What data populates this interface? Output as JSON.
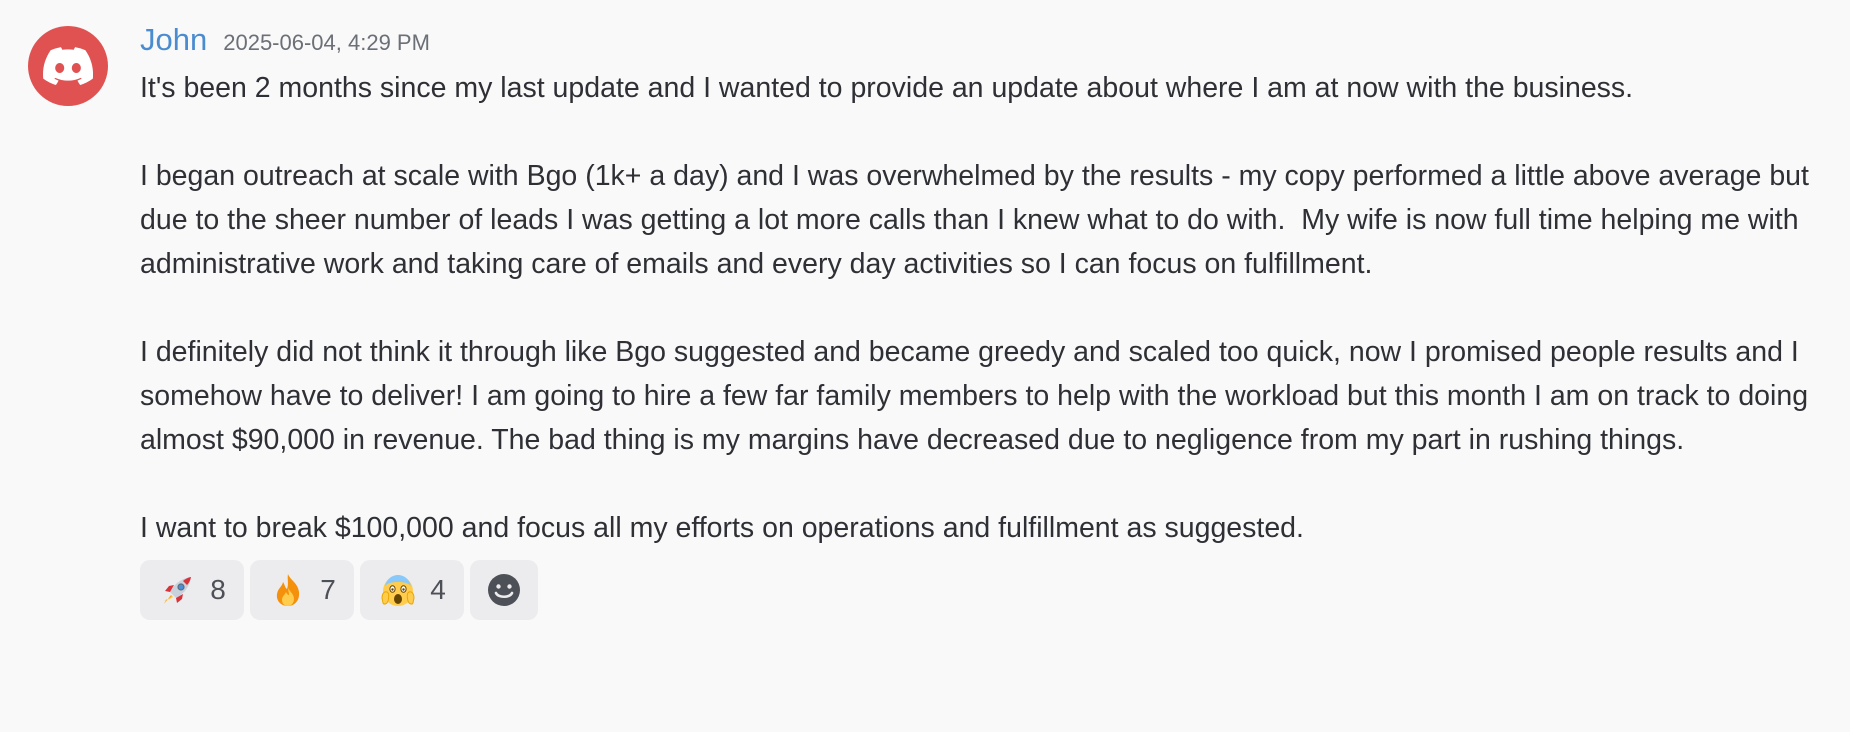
{
  "message": {
    "author": "John",
    "timestamp": "2025-06-04, 4:29 PM",
    "avatar_icon": "discord-logo-icon",
    "avatar_color": "#e05252",
    "username_color": "#4a8ccf",
    "paragraphs": [
      "It's been 2 months since my last update and I wanted to provide an update about where I am at now with the business.",
      "I began outreach at scale with Bgo (1k+ a day) and I was overwhelmed by the results - my copy performed a little above average but due to the sheer number of leads I was getting a lot more calls than I knew what to do with.  My wife is now full time helping me with administrative work and taking care of emails and every day activities so I can focus on fulfillment.",
      "I definitely did not think it through like Bgo suggested and became greedy and scaled too quick, now I promised people results and I somehow have to deliver! I am going to hire a few far family members to help with the workload but this month I am on track to doing almost $90,000 in revenue. The bad thing is my margins have decreased due to negligence from my part in rushing things.",
      "I want to break $100,000 and focus all my efforts on operations and fulfillment as suggested."
    ]
  },
  "reactions": [
    {
      "icon": "rocket-emoji-icon",
      "count": "8"
    },
    {
      "icon": "fire-emoji-icon",
      "count": "7"
    },
    {
      "icon": "screaming-face-emoji-icon",
      "count": "4"
    }
  ],
  "add_reaction_icon": "add-reaction-smiley-icon"
}
